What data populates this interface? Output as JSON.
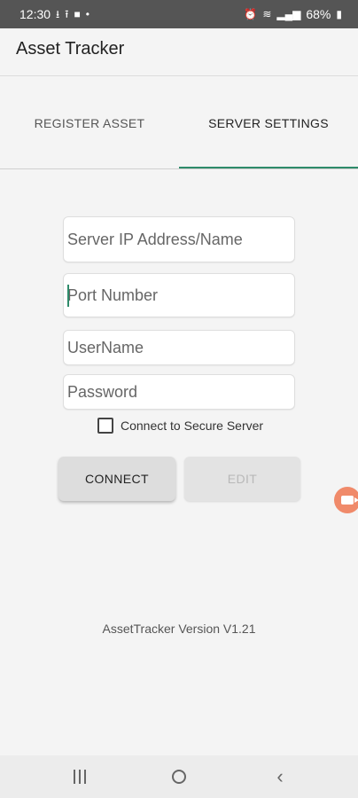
{
  "status_bar": {
    "time": "12:30",
    "battery": "68%",
    "left_icons": [
      "download-icon",
      "upload-icon",
      "camera-icon",
      "dot-icon"
    ],
    "right_icons": [
      "alarm-icon",
      "wifi-icon",
      "volte-icon",
      "signal-icon",
      "battery-icon"
    ]
  },
  "app_bar": {
    "title": "Asset Tracker"
  },
  "tabs": [
    {
      "label": "REGISTER ASSET",
      "selected": false
    },
    {
      "label": "SERVER SETTINGS",
      "selected": true
    }
  ],
  "form": {
    "server_ip": {
      "value": "",
      "placeholder": "Server IP Address/Name"
    },
    "port": {
      "value": "",
      "placeholder": "Port Number"
    },
    "username": {
      "value": "",
      "placeholder": "UserName"
    },
    "password": {
      "value": "",
      "placeholder": "Password"
    },
    "secure_checkbox": {
      "label": "Connect to Secure Server",
      "checked": false
    },
    "connect_label": "CONNECT",
    "edit_label": "EDIT"
  },
  "version_text": "AssetTracker Version V1.21",
  "colors": {
    "accent": "#2e8b6a",
    "status_bar": "#555555",
    "record_button": "#f08a6a"
  }
}
